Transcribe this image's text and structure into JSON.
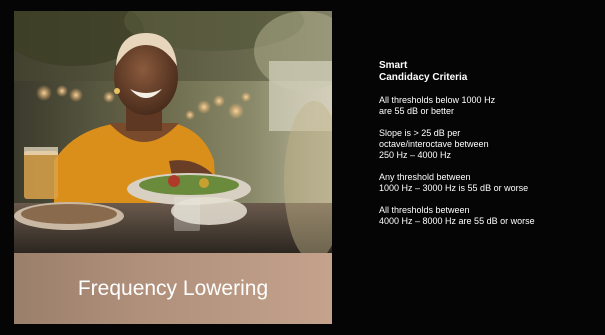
{
  "slide": {
    "caption": {
      "word1": "Frequency",
      "word2": "Lowering"
    },
    "criteria": {
      "title_line1": "Smart",
      "title_line2": "Candidacy Criteria",
      "items": [
        {
          "line1": "All thresholds below 1000 Hz",
          "line2": "are 55 dB or better",
          "line3": ""
        },
        {
          "line1": "Slope is > 25 dB per",
          "line2": "octave/interoctave between",
          "line3": "250 Hz – 4000 Hz"
        },
        {
          "line1": "Any threshold between",
          "line2": "1000 Hz – 3000 Hz is 55 dB or worse",
          "line3": ""
        },
        {
          "line1": "All thresholds between",
          "line2": "4000 Hz – 8000 Hz are 55 dB or worse",
          "line3": ""
        }
      ]
    }
  }
}
